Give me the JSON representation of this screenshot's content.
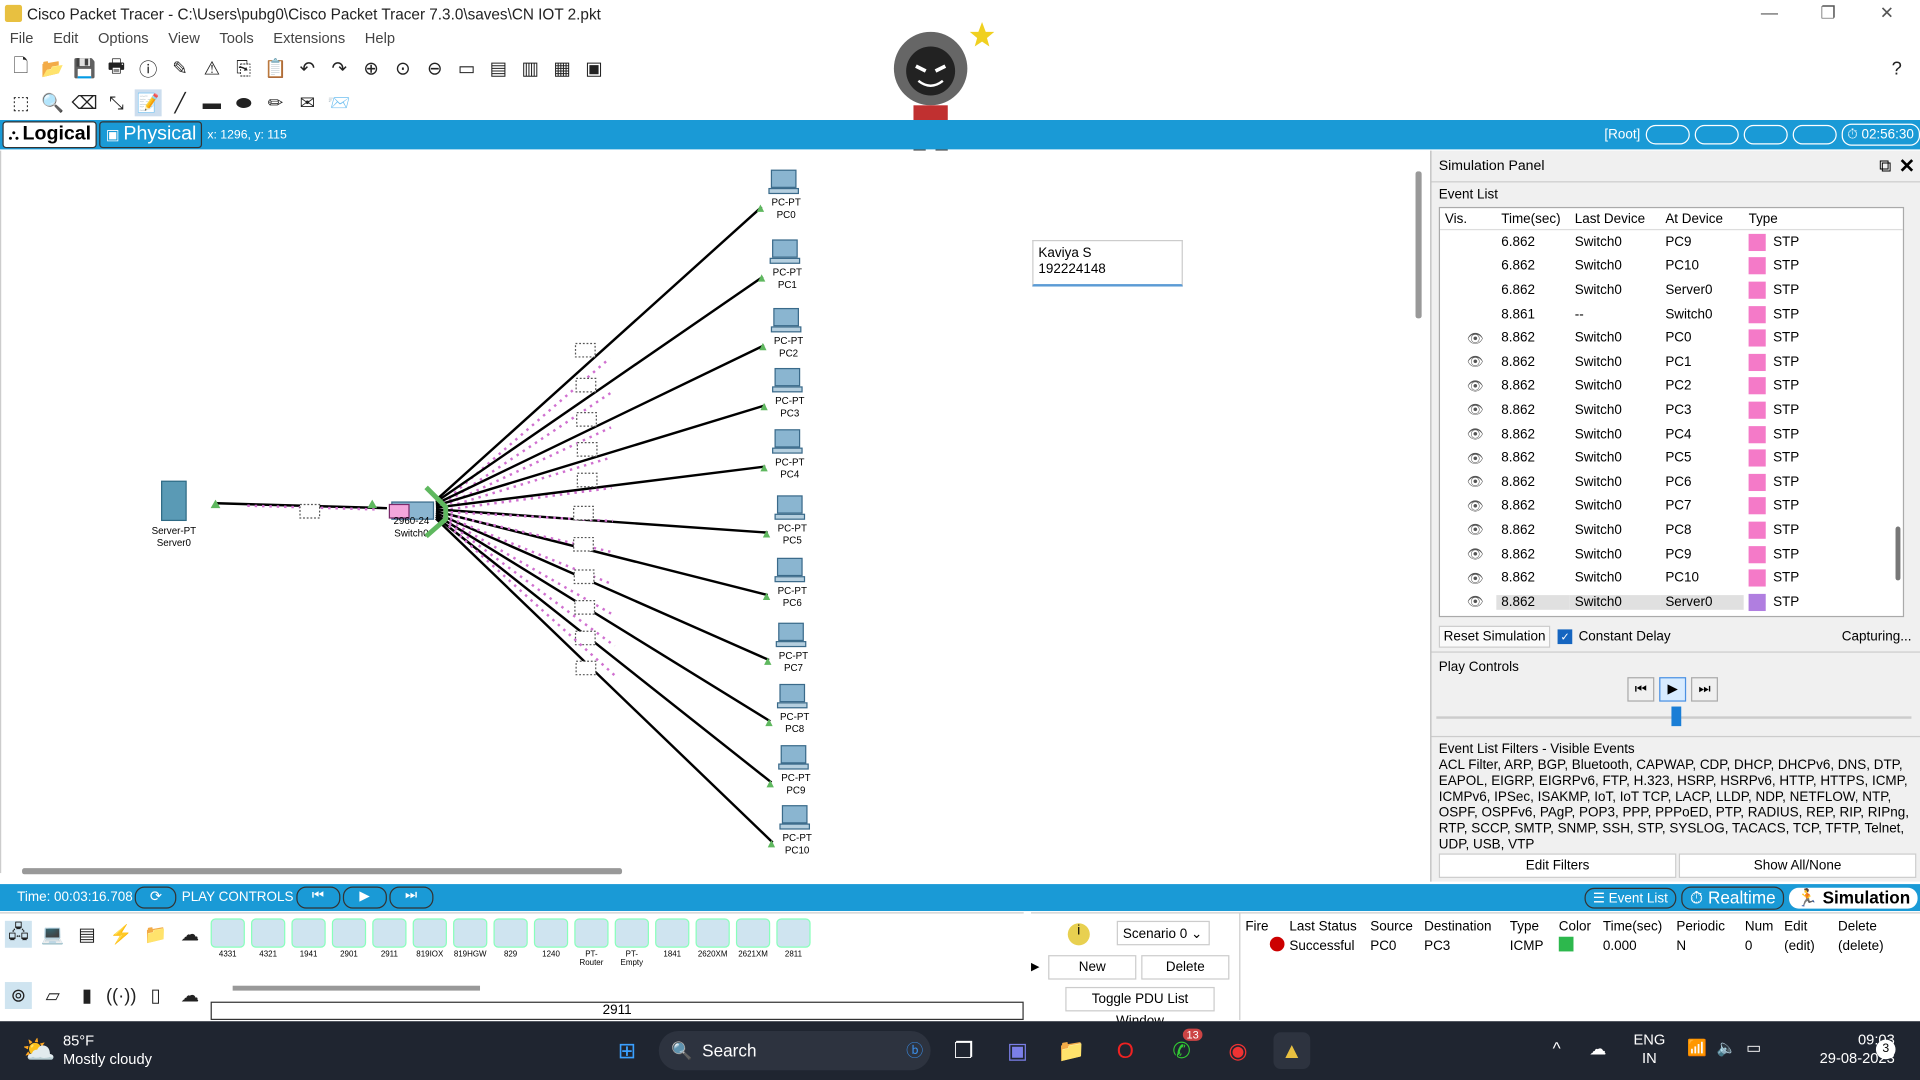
{
  "window": {
    "title": "Cisco Packet Tracer - C:\\Users\\pubg0\\Cisco Packet Tracer 7.3.0\\saves\\CN IOT 2.pkt",
    "help": "?"
  },
  "menu": [
    "File",
    "Edit",
    "Options",
    "View",
    "Tools",
    "Extensions",
    "Help"
  ],
  "tabs": {
    "logical": "Logical",
    "physical": "Physical",
    "coords": "x: 1296, y: 115"
  },
  "topright": {
    "root": "[Root]",
    "time": "02:56:30"
  },
  "note": {
    "line1": "Kaviya S",
    "line2": "192224148"
  },
  "topology": {
    "server": {
      "type": "Server-PT",
      "name": "Server0"
    },
    "switch": {
      "type": "2960-24",
      "name": "Switch0"
    },
    "pcs": [
      {
        "type": "PC-PT",
        "name": "PC0"
      },
      {
        "type": "PC-PT",
        "name": "PC1"
      },
      {
        "type": "PC-PT",
        "name": "PC2"
      },
      {
        "type": "PC-PT",
        "name": "PC3"
      },
      {
        "type": "PC-PT",
        "name": "PC4"
      },
      {
        "type": "PC-PT",
        "name": "PC5"
      },
      {
        "type": "PC-PT",
        "name": "PC6"
      },
      {
        "type": "PC-PT",
        "name": "PC7"
      },
      {
        "type": "PC-PT",
        "name": "PC8"
      },
      {
        "type": "PC-PT",
        "name": "PC9"
      },
      {
        "type": "PC-PT",
        "name": "PC10"
      }
    ]
  },
  "simulation": {
    "title": "Simulation Panel",
    "event_list_label": "Event List",
    "columns": [
      "Vis.",
      "Time(sec)",
      "Last Device",
      "At Device",
      "Type"
    ],
    "events": [
      {
        "vis": "",
        "time": "6.862",
        "last": "Switch0",
        "at": "PC9",
        "type": "STP"
      },
      {
        "vis": "",
        "time": "6.862",
        "last": "Switch0",
        "at": "PC10",
        "type": "STP"
      },
      {
        "vis": "",
        "time": "6.862",
        "last": "Switch0",
        "at": "Server0",
        "type": "STP"
      },
      {
        "vis": "",
        "time": "8.861",
        "last": "--",
        "at": "Switch0",
        "type": "STP"
      },
      {
        "vis": "eye",
        "time": "8.862",
        "last": "Switch0",
        "at": "PC0",
        "type": "STP"
      },
      {
        "vis": "eye",
        "time": "8.862",
        "last": "Switch0",
        "at": "PC1",
        "type": "STP"
      },
      {
        "vis": "eye",
        "time": "8.862",
        "last": "Switch0",
        "at": "PC2",
        "type": "STP"
      },
      {
        "vis": "eye",
        "time": "8.862",
        "last": "Switch0",
        "at": "PC3",
        "type": "STP"
      },
      {
        "vis": "eye",
        "time": "8.862",
        "last": "Switch0",
        "at": "PC4",
        "type": "STP"
      },
      {
        "vis": "eye",
        "time": "8.862",
        "last": "Switch0",
        "at": "PC5",
        "type": "STP"
      },
      {
        "vis": "eye",
        "time": "8.862",
        "last": "Switch0",
        "at": "PC6",
        "type": "STP"
      },
      {
        "vis": "eye",
        "time": "8.862",
        "last": "Switch0",
        "at": "PC7",
        "type": "STP"
      },
      {
        "vis": "eye",
        "time": "8.862",
        "last": "Switch0",
        "at": "PC8",
        "type": "STP"
      },
      {
        "vis": "eye",
        "time": "8.862",
        "last": "Switch0",
        "at": "PC9",
        "type": "STP"
      },
      {
        "vis": "eye",
        "time": "8.862",
        "last": "Switch0",
        "at": "PC10",
        "type": "STP"
      },
      {
        "vis": "eye",
        "time": "8.862",
        "last": "Switch0",
        "at": "Server0",
        "type": "STP"
      }
    ],
    "reset": "Reset Simulation",
    "constant_delay": "Constant Delay",
    "capturing": "Capturing...",
    "play_controls": "Play Controls",
    "filters_title": "Event List Filters - Visible Events",
    "filters_text": "ACL Filter, ARP, BGP, Bluetooth, CAPWAP, CDP, DHCP, DHCPv6, DNS, DTP, EAPOL, EIGRP, EIGRPv6, FTP, H.323, HSRP, HSRPv6, HTTP, HTTPS, ICMP, ICMPv6, IPSec, ISAKMP, IoT, IoT TCP, LACP, LLDP, NDP, NETFLOW, NTP, OSPF, OSPFv6, PAgP, POP3, PPP, PPPoED, PTP, RADIUS, REP, RIP, RIPng, RTP, SCCP, SMTP, SNMP, SSH, STP, SYSLOG, TACACS, TCP, TFTP, Telnet, UDP, USB, VTP",
    "edit_filters": "Edit Filters",
    "show_all": "Show All/None"
  },
  "bottom": {
    "time": "Time: 00:03:16.708",
    "play_controls": "PLAY CONTROLS",
    "event_list": "Event List",
    "realtime": "Realtime",
    "simulation": "Simulation"
  },
  "devices": {
    "routers": [
      "4331",
      "4321",
      "1941",
      "2901",
      "2911",
      "819IOX",
      "819HGW",
      "829",
      "1240",
      "PT-Router",
      "PT-Empty",
      "1841",
      "2620XM",
      "2621XM",
      "2811"
    ],
    "selected": "2911"
  },
  "pdu": {
    "scenario": "Scenario 0",
    "new": "New",
    "delete": "Delete",
    "toggle": "Toggle PDU List Window",
    "columns": [
      "Fire",
      "Last Status",
      "Source",
      "Destination",
      "Type",
      "Color",
      "Time(sec)",
      "Periodic",
      "Num",
      "Edit",
      "Delete"
    ],
    "rows": [
      {
        "status": "Successful",
        "source": "PC0",
        "dest": "PC3",
        "type": "ICMP",
        "time": "0.000",
        "periodic": "N",
        "num": "0",
        "edit": "(edit)",
        "delete": "(delete)"
      }
    ]
  },
  "taskbar": {
    "temp": "85°F",
    "weather": "Mostly cloudy",
    "search": "Search",
    "lang1": "ENG",
    "lang2": "IN",
    "time": "09:03",
    "date": "29-08-2023",
    "whatsapp_badge": "13",
    "notif": "3"
  }
}
